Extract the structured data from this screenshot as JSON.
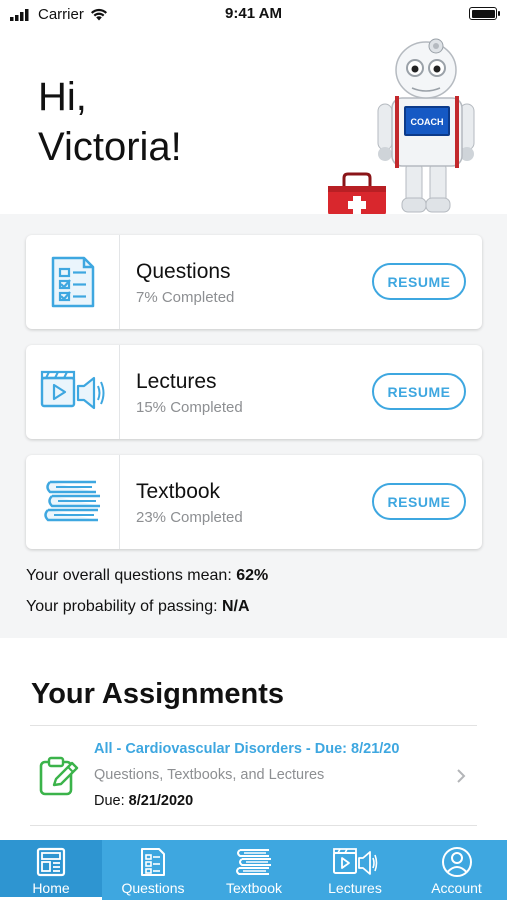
{
  "status_bar": {
    "carrier": "Carrier",
    "time": "9:41 AM"
  },
  "header": {
    "greeting_line1": "Hi,",
    "greeting_line2": "Victoria!",
    "robot_screen_text": "COACH"
  },
  "cards": [
    {
      "title": "Questions",
      "subtitle": "7% Completed",
      "button": "RESUME",
      "icon": "checklist-icon"
    },
    {
      "title": "Lectures",
      "subtitle": "15% Completed",
      "button": "RESUME",
      "icon": "video-lecture-icon"
    },
    {
      "title": "Textbook",
      "subtitle": "23% Completed",
      "button": "RESUME",
      "icon": "books-icon"
    }
  ],
  "stats": {
    "mean_label": "Your overall questions mean:",
    "mean_value": "62%",
    "passing_label": "Your probability of passing:",
    "passing_value": "N/A"
  },
  "assignments": {
    "heading": "Your Assignments",
    "items": [
      {
        "name": "All - Cardiovascular Disorders - Due: 8/21/20",
        "description": "Questions, Textbooks, and Lectures",
        "due_label": "Due:",
        "due_value": "8/21/2020"
      }
    ]
  },
  "tab_bar": {
    "tabs": [
      {
        "label": "Home",
        "icon": "home-icon",
        "active": true
      },
      {
        "label": "Questions",
        "icon": "questions-icon",
        "active": false
      },
      {
        "label": "Textbook",
        "icon": "textbook-icon",
        "active": false
      },
      {
        "label": "Lectures",
        "icon": "lectures-icon",
        "active": false
      },
      {
        "label": "Account",
        "icon": "account-icon",
        "active": false
      }
    ]
  },
  "colors": {
    "accent": "#3ea7e0",
    "tab_bar": "#3ea7e0",
    "assignment_icon": "#3bb34a",
    "progress_bg": "#f4f5f6"
  }
}
